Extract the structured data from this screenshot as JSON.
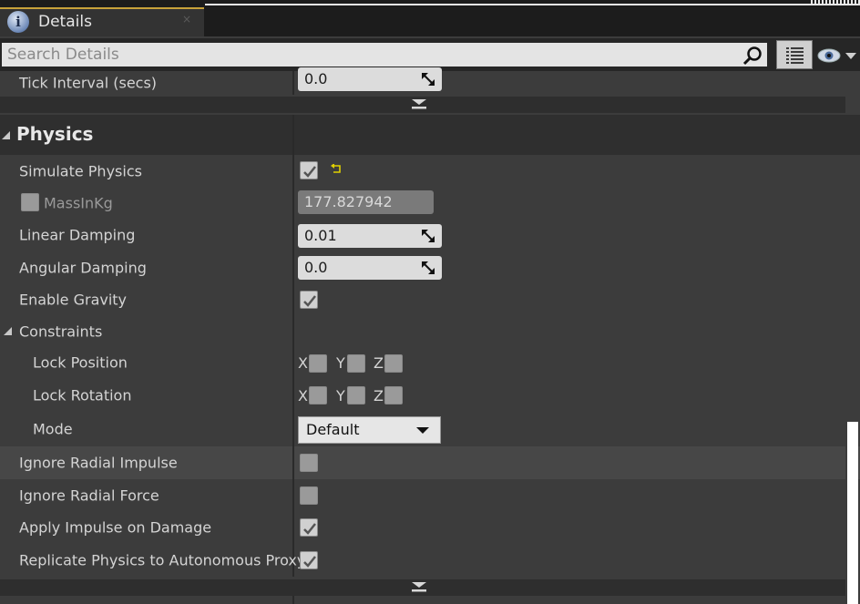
{
  "tab": {
    "title": "Details",
    "icon": "info-icon",
    "close": "×"
  },
  "search": {
    "placeholder": "Search Details"
  },
  "top_row": {
    "label": "Tick Interval (secs)",
    "value": "0.0"
  },
  "section": {
    "title": "Physics"
  },
  "rows": {
    "simulate_physics": {
      "label": "Simulate Physics",
      "checked": true
    },
    "mass": {
      "label": "MassInKg",
      "value": "177.827942",
      "override_checked": false
    },
    "linear_damping": {
      "label": "Linear Damping",
      "value": "0.01"
    },
    "angular_damping": {
      "label": "Angular Damping",
      "value": "0.0"
    },
    "enable_gravity": {
      "label": "Enable Gravity",
      "checked": true
    },
    "constraints": {
      "label": "Constraints"
    },
    "lock_position": {
      "label": "Lock Position",
      "x": "X",
      "y": "Y",
      "z": "Z"
    },
    "lock_rotation": {
      "label": "Lock Rotation",
      "x": "X",
      "y": "Y",
      "z": "Z"
    },
    "mode": {
      "label": "Mode",
      "value": "Default"
    },
    "ignore_radial_impulse": {
      "label": "Ignore Radial Impulse",
      "checked": false
    },
    "ignore_radial_force": {
      "label": "Ignore Radial Force",
      "checked": false
    },
    "apply_impulse_on_damage": {
      "label": "Apply Impulse on Damage",
      "checked": true
    },
    "replicate_physics": {
      "label": "Replicate Physics to Autonomous Proxy",
      "checked": true
    }
  },
  "colors": {
    "accent_tab": "#c8a23a",
    "reset_arrow": "#e0d000",
    "panel_bg": "#3c3c3c"
  }
}
